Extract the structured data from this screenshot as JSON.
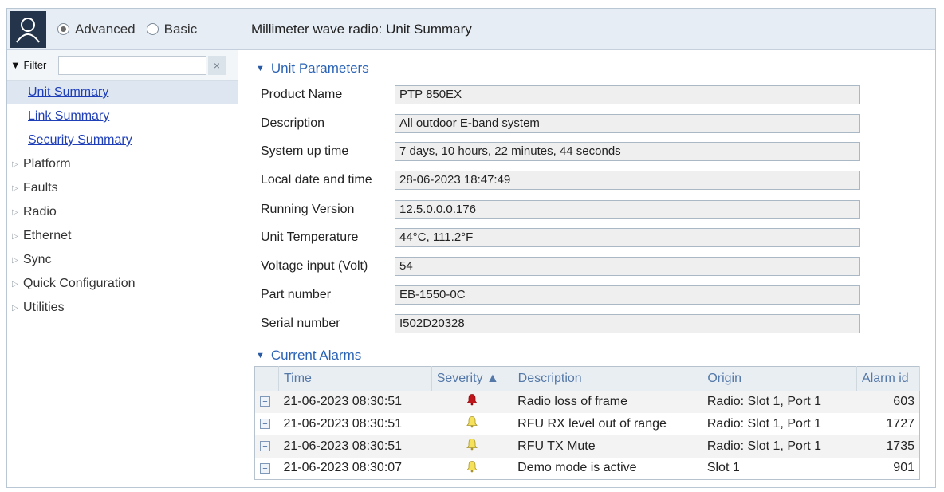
{
  "sidebar": {
    "modes": [
      {
        "label": "Advanced",
        "checked": true
      },
      {
        "label": "Basic",
        "checked": false
      }
    ],
    "filter": {
      "label": "Filter",
      "value": "",
      "clear_icon": "×"
    },
    "nav": [
      {
        "label": "Unit Summary",
        "type": "link",
        "active": true
      },
      {
        "label": "Link Summary",
        "type": "link",
        "active": false
      },
      {
        "label": "Security Summary",
        "type": "link",
        "active": false
      },
      {
        "label": "Platform",
        "type": "group"
      },
      {
        "label": "Faults",
        "type": "group"
      },
      {
        "label": "Radio",
        "type": "group"
      },
      {
        "label": "Ethernet",
        "type": "group"
      },
      {
        "label": "Sync",
        "type": "group"
      },
      {
        "label": "Quick Configuration",
        "type": "group"
      },
      {
        "label": "Utilities",
        "type": "group"
      }
    ]
  },
  "main": {
    "title": "Millimeter wave radio: Unit Summary",
    "unit_parameters": {
      "title": "Unit Parameters",
      "fields": [
        {
          "label": "Product Name",
          "value": "PTP 850EX"
        },
        {
          "label": "Description",
          "value": "All outdoor E-band system"
        },
        {
          "label": "System up time",
          "value": "7 days, 10 hours, 22 minutes, 44 seconds"
        },
        {
          "label": "Local date and time",
          "value": "28-06-2023 18:47:49"
        },
        {
          "label": "Running Version",
          "value": "12.5.0.0.0.176"
        },
        {
          "label": "Unit Temperature",
          "value": "44°C, 111.2°F"
        },
        {
          "label": "Voltage input (Volt)",
          "value": "54"
        },
        {
          "label": "Part number",
          "value": "EB-1550-0C"
        },
        {
          "label": "Serial number",
          "value": "I502D20328"
        }
      ]
    },
    "current_alarms": {
      "title": "Current Alarms",
      "columns": [
        "Time",
        "Severity ▲",
        "Description",
        "Origin",
        "Alarm id"
      ],
      "rows": [
        {
          "time": "21-06-2023 08:30:51",
          "severity": "critical",
          "description": "Radio loss of frame",
          "origin": "Radio: Slot 1, Port 1",
          "alarm_id": "603"
        },
        {
          "time": "21-06-2023 08:30:51",
          "severity": "minor",
          "description": "RFU RX level out of range",
          "origin": "Radio: Slot 1, Port 1",
          "alarm_id": "1727"
        },
        {
          "time": "21-06-2023 08:30:51",
          "severity": "minor",
          "description": "RFU TX Mute",
          "origin": "Radio: Slot 1, Port 1",
          "alarm_id": "1735"
        },
        {
          "time": "21-06-2023 08:30:07",
          "severity": "minor",
          "description": "Demo mode is active",
          "origin": "Slot 1",
          "alarm_id": "901"
        }
      ]
    }
  },
  "colors": {
    "critical_bell": "#c0161b",
    "minor_bell": "#f5e15a",
    "link": "#1f3fb8",
    "section_title": "#2a63b6"
  }
}
